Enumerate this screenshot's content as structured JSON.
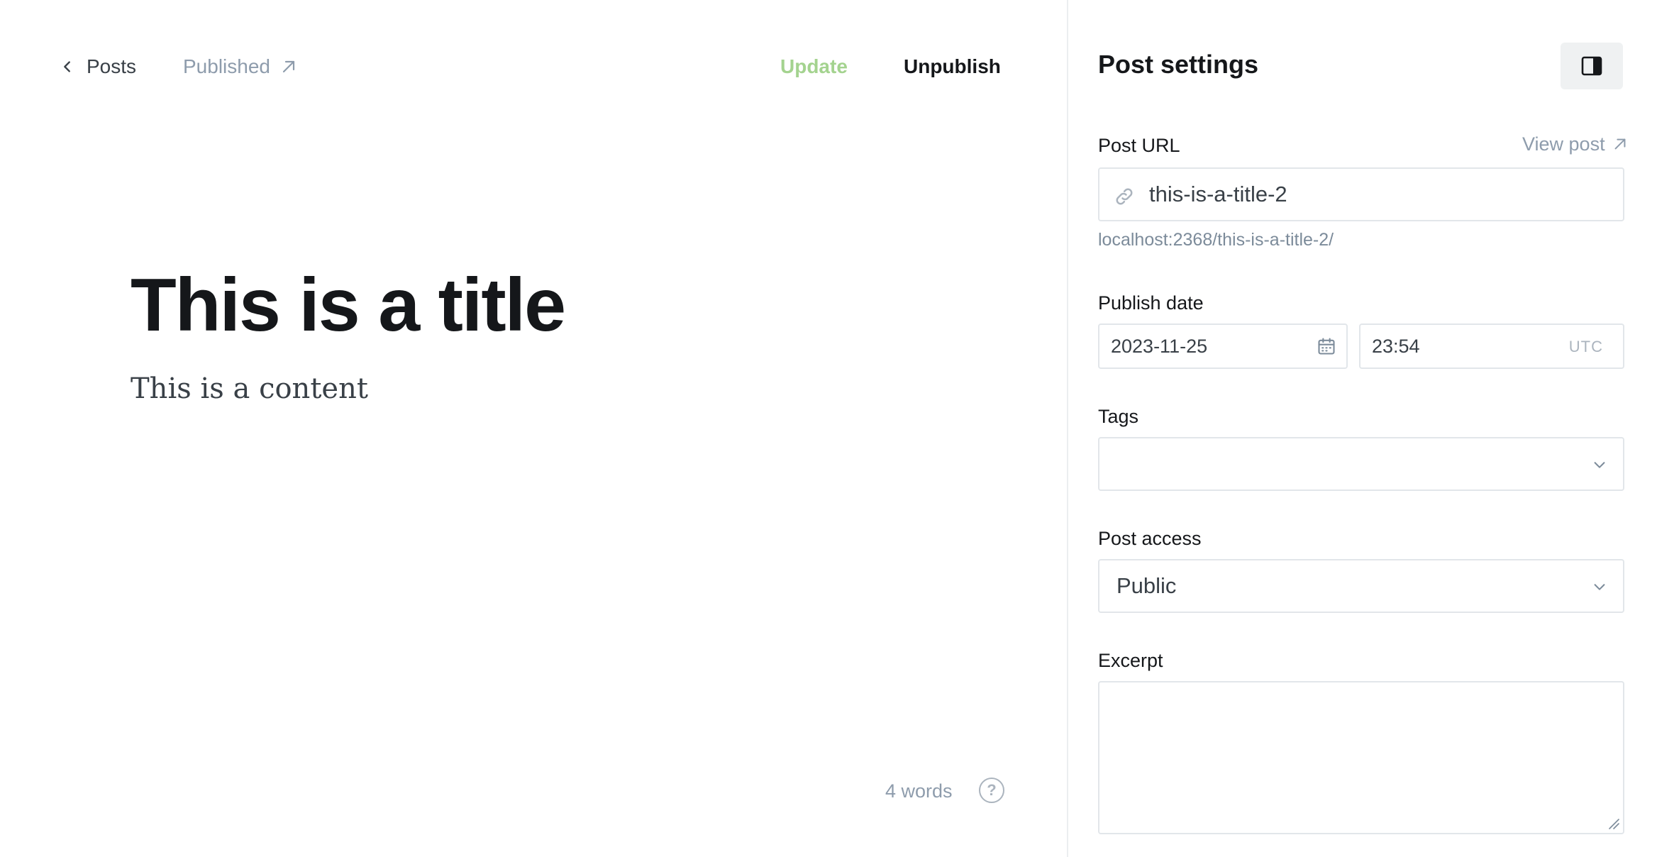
{
  "editor": {
    "back_label": "Posts",
    "status_label": "Published",
    "update_label": "Update",
    "unpublish_label": "Unpublish",
    "title": "This is a title",
    "content": "This is a content",
    "word_count": "4 words",
    "help_glyph": "?"
  },
  "sidebar": {
    "title": "Post settings",
    "post_url": {
      "label": "Post URL",
      "view_post_label": "View post",
      "value": "this-is-a-title-2",
      "hint": "localhost:2368/this-is-a-title-2/"
    },
    "publish_date": {
      "label": "Publish date",
      "date": "2023-11-25",
      "time": "23:54",
      "timezone": "UTC"
    },
    "tags": {
      "label": "Tags",
      "value": ""
    },
    "post_access": {
      "label": "Post access",
      "value": "Public"
    },
    "excerpt": {
      "label": "Excerpt",
      "value": ""
    }
  },
  "colors": {
    "update_accent": "#a4d38f",
    "muted_text": "#8e9cac",
    "border": "#e2e6ea"
  },
  "icons": [
    "chevron-left-icon",
    "arrow-up-right-icon",
    "sidebar-toggle-icon",
    "link-icon",
    "calendar-icon",
    "chevron-down-icon",
    "help-icon"
  ]
}
